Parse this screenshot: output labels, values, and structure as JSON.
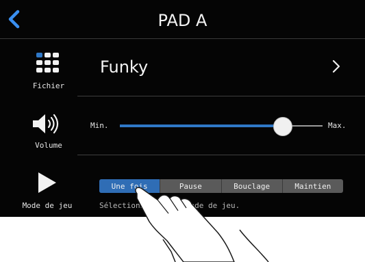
{
  "header": {
    "title": "PAD A",
    "back_icon": "chevron-left-icon"
  },
  "file_row": {
    "icon_label": "Fichier",
    "file_name": "Funky"
  },
  "volume_row": {
    "icon_label": "Volume",
    "min_label": "Min.",
    "max_label": "Max.",
    "level": 0.8
  },
  "mode_row": {
    "icon_label": "Mode de jeu",
    "options": [
      "Une fois",
      "Pause",
      "Bouclage",
      "Maintien"
    ],
    "selected_index": 0,
    "hint": "Sélectionnez la méthode de jeu."
  },
  "colors": {
    "accent": "#2F6DB5",
    "background": "#050505"
  }
}
